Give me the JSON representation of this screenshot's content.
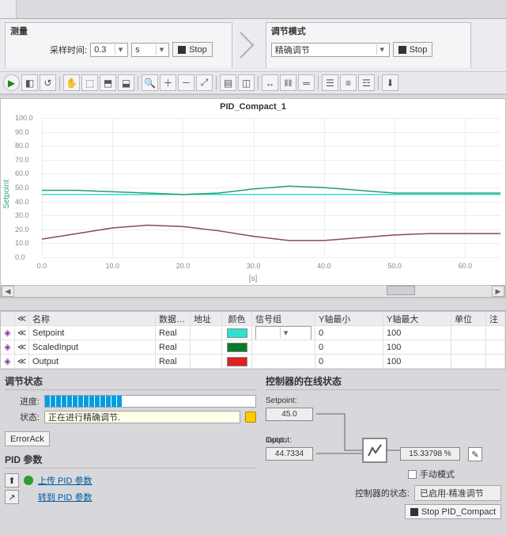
{
  "tabs": {
    "t1": ""
  },
  "ribbon": {
    "panel1": {
      "title": "测量",
      "sample_label": "采样时间:",
      "sample_val": "0.3",
      "sample_unit": "s",
      "stop": "Stop"
    },
    "panel2": {
      "title": "调节模式",
      "mode": "精确调节",
      "stop": "Stop"
    }
  },
  "chart_data": {
    "type": "line",
    "title": "PID_Compact_1",
    "ylabel": "Setpoint",
    "xlabel": "[s]",
    "ylim": [
      0,
      100
    ],
    "yticks": [
      0,
      10,
      20,
      30,
      40,
      50,
      60,
      70,
      80,
      90,
      100
    ],
    "x": [
      0,
      5,
      10,
      15,
      20,
      25,
      30,
      35,
      40,
      45,
      50,
      55,
      60,
      65
    ],
    "series": [
      {
        "name": "Setpoint",
        "color": "#2ee0d0",
        "values": [
          45,
          45,
          45,
          45,
          45,
          45,
          45,
          45,
          45,
          45,
          45,
          45,
          45,
          45
        ]
      },
      {
        "name": "ScaledInput",
        "color": "#2a9d6a",
        "values": [
          48,
          48,
          47,
          46,
          45,
          46,
          49,
          51,
          50,
          48,
          46,
          46,
          46,
          46
        ]
      },
      {
        "name": "Output",
        "color": "#8a4a4a",
        "values": [
          13,
          17,
          21,
          23,
          22,
          19,
          15,
          12,
          12,
          14,
          16,
          17,
          17,
          17
        ]
      }
    ]
  },
  "table": {
    "headers": {
      "name": "名称",
      "datatype": "数据…",
      "addr": "地址",
      "color": "颜色",
      "siggrp": "信号组",
      "ymin": "Y轴最小",
      "ymax": "Y轴最大",
      "unit": "单位",
      "note": "注"
    },
    "rows": [
      {
        "name": "Setpoint",
        "datatype": "Real",
        "color": "#2ee0d0",
        "ymin": "0",
        "ymax": "100"
      },
      {
        "name": "ScaledInput",
        "datatype": "Real",
        "color": "#0a7a2a",
        "ymin": "0",
        "ymax": "100"
      },
      {
        "name": "Output",
        "datatype": "Real",
        "color": "#e02020",
        "ymin": "0",
        "ymax": "100"
      }
    ]
  },
  "tune_state": {
    "title": "调节状态",
    "progress_label": "进度:",
    "status_label": "状态:",
    "status_text": "正在进行精确调节.",
    "errorack": "ErrorAck"
  },
  "pid_params": {
    "title": "PID 参数",
    "upload": "上传 PID 参数",
    "goto": "转到 PID 参数"
  },
  "controller": {
    "title": "控制器的在线状态",
    "setpoint_lbl": "Setpoint:",
    "setpoint_val": "45.0",
    "input_lbl": "Input:",
    "input_val": "44.7334",
    "output_lbl": "Output:",
    "output_val": "15.33798",
    "output_unit": "%",
    "manual": "手动模式",
    "state_lbl": "控制器的状态:",
    "state_val": "已启用-精准调节",
    "stop_btn": "Stop PID_Compact"
  }
}
